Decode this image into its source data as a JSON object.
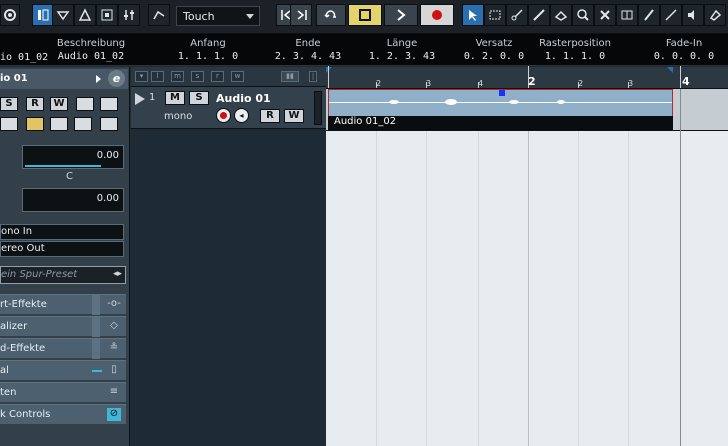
{
  "toolbar": {
    "automation_mode": "Touch"
  },
  "infoline": {
    "columns": [
      {
        "header": "Beschreibung",
        "value": "Audio 01_02"
      },
      {
        "header": "Anfang",
        "value": "1. 1. 1.   0"
      },
      {
        "header": "Ende",
        "value": "2. 3. 4. 43"
      },
      {
        "header": "Länge",
        "value": "1. 2. 3. 43"
      },
      {
        "header": "Versatz",
        "value": "0. 2. 0.   0"
      },
      {
        "header": "Rasterposition",
        "value": "1. 1. 1.   0"
      },
      {
        "header": "Fade-In",
        "value": "0. 0. 0.   0"
      }
    ],
    "left_value": "io 01_02"
  },
  "inspector": {
    "title": "io 01",
    "edit_letter": "e",
    "buttons": {
      "solo": "S",
      "read": "R",
      "write": "W"
    },
    "volume": "0.00",
    "pan_label": "C",
    "pan_value": "0.00",
    "input_routing": "ono In",
    "output_routing": "ereo Out",
    "preset": "ein Spur-Preset",
    "sections": [
      {
        "label": "rt-Effekte"
      },
      {
        "label": "alizer"
      },
      {
        "label": "d-Effekte"
      },
      {
        "label": "al"
      },
      {
        "label": "ten"
      },
      {
        "label": "k Controls"
      }
    ]
  },
  "track": {
    "number": "1",
    "name": "Audio 01",
    "mute": "M",
    "solo": "S",
    "type": "mono",
    "read": "R",
    "write": "W",
    "header_icons": [
      "l",
      "m",
      "s",
      "r",
      "w"
    ]
  },
  "ruler": {
    "labels": [
      {
        "text": "2",
        "big": false
      },
      {
        "text": "3",
        "big": false
      },
      {
        "text": "4",
        "big": false
      },
      {
        "text": "2",
        "big": true
      },
      {
        "text": "2",
        "big": false
      },
      {
        "text": "3",
        "big": false
      },
      {
        "text": "4",
        "big": true
      }
    ]
  },
  "event": {
    "label": "Audio 01_02"
  },
  "colors": {
    "accent": "#3fb8d8",
    "event_fill": "#8fb0c8",
    "event_border": "#b02a2a",
    "record": "#d01010",
    "cycle": "#e2d36a"
  }
}
